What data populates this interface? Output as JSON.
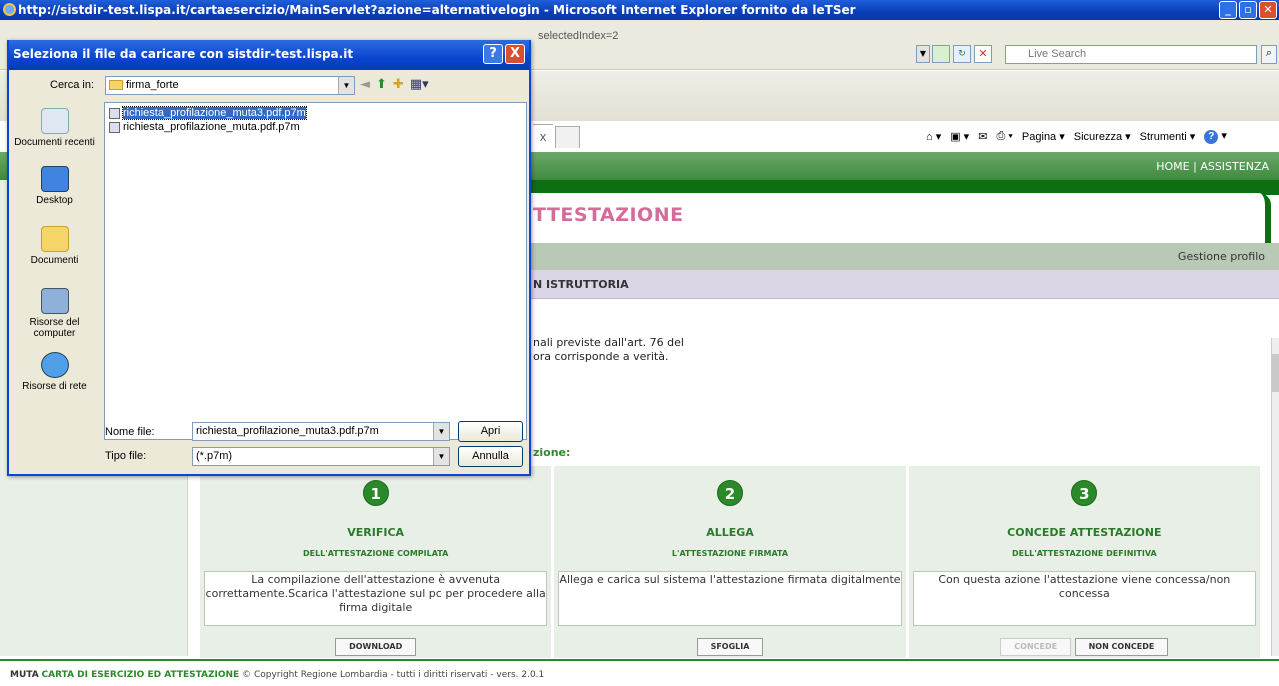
{
  "browser": {
    "title": "http://sistdir-test.lispa.it/cartaesercizio/MainServlet?azione=alternativelogin - Microsoft Internet Explorer fornito da leTSer",
    "address_fragment": "selectedIndex=2",
    "search_placeholder": "Live Search",
    "tab_close": "x",
    "toolbar": {
      "pagina": "Pagina",
      "sicurezza": "Sicurezza",
      "strumenti": "Strumenti"
    }
  },
  "site": {
    "topnav": "HOME | ASSISTENZA",
    "title": "TTESTAZIONE",
    "gestione": "Gestione profilo",
    "section": "N ISTRUTTORIA",
    "body_line1": "nali previste dall'art. 76 del",
    "body_line2": "ora corrisponde a verità.",
    "zione": "zione:",
    "steps": [
      {
        "num": "1",
        "title": "VERIFICA",
        "sub": "DELL'ATTESTAZIONE COMPILATA",
        "desc": "La compilazione dell'attestazione è avvenuta correttamente.Scarica l'attestazione sul pc per procedere alla firma digitale",
        "buttons": [
          "DOWNLOAD"
        ]
      },
      {
        "num": "2",
        "title": "ALLEGA",
        "sub": "L'ATTESTAZIONE FIRMATA",
        "desc": "Allega e carica sul sistema l'attestazione firmata digitalmente",
        "buttons": [
          "SFOGLIA"
        ]
      },
      {
        "num": "3",
        "title": "CONCEDE ATTESTAZIONE",
        "sub": "DELL'ATTESTAZIONE DEFINITIVA",
        "desc": "Con questa azione l'attestazione viene concessa/non concessa",
        "buttons": [
          "CONCEDE",
          "NON CONCEDE"
        ]
      }
    ],
    "footer": {
      "brand1": "MUTA",
      "brand2": "CARTA DI ESERCIZIO ED ATTESTAZIONE",
      "copyright": "© Copyright Regione Lombardia - tutti i diritti riservati - vers. 2.0.1"
    }
  },
  "dialog": {
    "title": "Seleziona il file da caricare con sistdir-test.lispa.it",
    "help": "?",
    "close": "X",
    "cerca_in_label": "Cerca in:",
    "folder": "firma_forte",
    "places": [
      "Documenti recenti",
      "Desktop",
      "Documenti",
      "Risorse del computer",
      "Risorse di rete"
    ],
    "files": [
      "richiesta_profilazione_muta3.pdf.p7m",
      "richiesta_profilazione_muta.pdf.p7m"
    ],
    "nome_file_label": "Nome file:",
    "nome_file_value": "richiesta_profilazione_muta3.pdf.p7m",
    "tipo_file_label": "Tipo file:",
    "tipo_file_value": "(*.p7m)",
    "open_button": "Apri",
    "cancel_button": "Annulla"
  }
}
